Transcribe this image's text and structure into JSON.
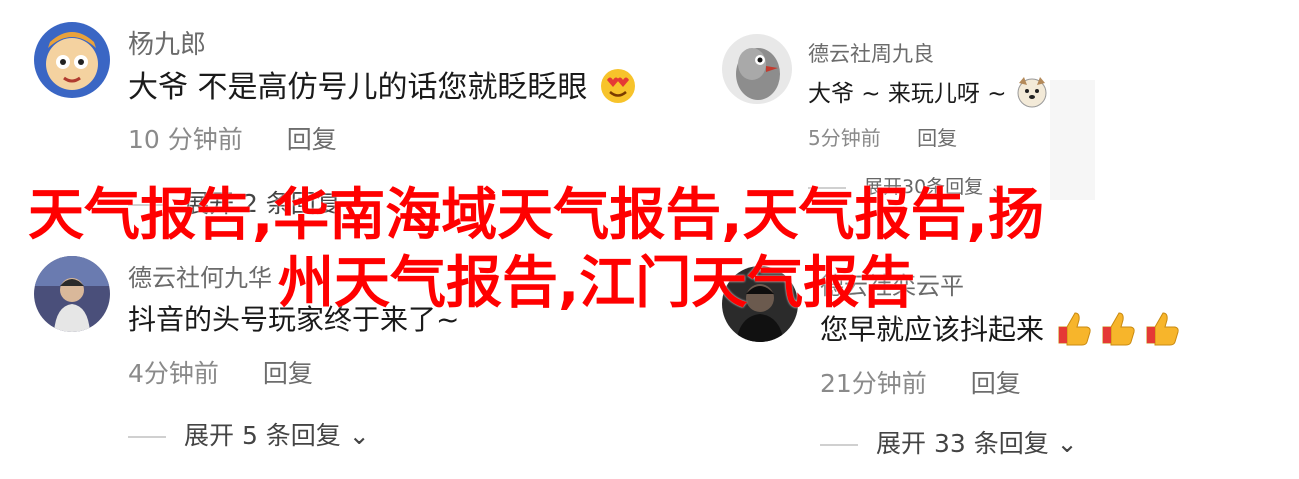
{
  "comments": [
    {
      "username": "杨九郎",
      "text": "大爷 不是高仿号儿的话您就眨眨眼",
      "time": "10 分钟前",
      "reply": "回复",
      "emoji": "heart-eyes-emoji"
    },
    {
      "username": "德云社周九良",
      "text": "大爷 ~ 来玩儿呀 ~",
      "time": "5分钟前",
      "reply": "回复",
      "expand": "展开30条回复",
      "emoji": "dog-face-emoji"
    },
    {
      "username": "德云社何九华",
      "text": "抖音的头号玩家终于来了~",
      "time": "4分钟前",
      "reply": "回复",
      "expand": "展开 5 条回复"
    },
    {
      "username": "德云社栾云平",
      "text": "您早就应该抖起来",
      "time": "21分钟前",
      "reply": "回复",
      "expand": "展开 33 条回复",
      "emoji": "thumbs-up-emoji"
    }
  ],
  "left_first_expand": "展开 2 条回复",
  "overlay": {
    "line1": "天气报告,华南海域天气报告,天气报告,扬",
    "line2": "州天气报告,江门天气报告",
    "color": "#ff0000"
  }
}
